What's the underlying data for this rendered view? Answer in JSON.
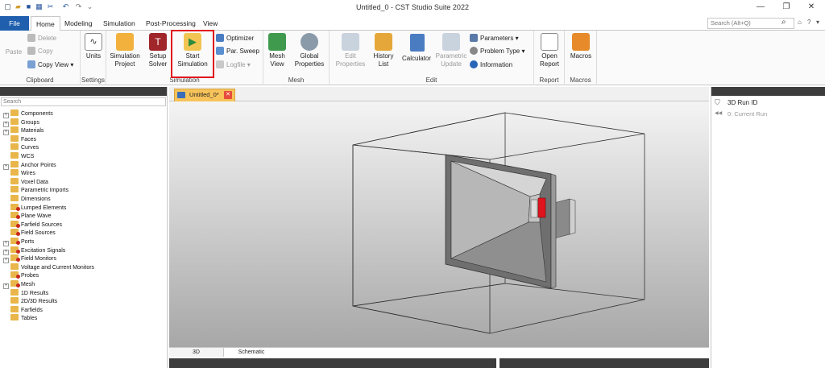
{
  "window": {
    "title": "Untitled_0 - CST Studio Suite 2022",
    "controls": [
      "minimize",
      "maximize",
      "close"
    ]
  },
  "quick_access": [
    "new-icon",
    "open-icon",
    "save-icon",
    "save-all-icon",
    "cut-icon",
    "undo-icon",
    "redo-icon",
    "customize-icon"
  ],
  "ribbon_tabs": [
    {
      "label": "File"
    },
    {
      "label": "Home"
    },
    {
      "label": "Modeling"
    },
    {
      "label": "Simulation"
    },
    {
      "label": "Post-Processing"
    },
    {
      "label": "View"
    }
  ],
  "search": {
    "placeholder": "Search (Alt+Q)"
  },
  "groups": {
    "clipboard": {
      "label": "Clipboard",
      "paste": "Paste",
      "delete": "Delete",
      "copy": "Copy",
      "copy_view": "Copy View"
    },
    "settings": {
      "label": "Settings",
      "units": "Units"
    },
    "simulation": {
      "label": "Simulation",
      "simulation_project": "Simulation Project",
      "setup_solver": "Setup Solver",
      "start_simulation": "Start Simulation",
      "optimizer": "Optimizer",
      "par_sweep": "Par. Sweep",
      "logfile": "Logfile"
    },
    "mesh": {
      "label": "Mesh",
      "mesh_view": "Mesh View",
      "global_properties": "Global Properties"
    },
    "edit": {
      "label": "Edit",
      "edit_properties": "Edit Properties",
      "history_list": "History List",
      "calculator": "Calculator",
      "parametric_update": "Parametric Update",
      "parameters": "Parameters",
      "problem_type": "Problem Type",
      "information": "Information"
    },
    "report": {
      "label": "Report",
      "open_report": "Open Report"
    },
    "macros": {
      "label": "Macros",
      "macros": "Macros"
    }
  },
  "navigation_tree": {
    "search_placeholder": "Search",
    "items": [
      {
        "label": "Components",
        "expandable": true
      },
      {
        "label": "Groups",
        "expandable": true
      },
      {
        "label": "Materials",
        "expandable": true
      },
      {
        "label": "Faces",
        "expandable": false
      },
      {
        "label": "Curves",
        "expandable": false
      },
      {
        "label": "WCS",
        "expandable": false
      },
      {
        "label": "Anchor Points",
        "expandable": true
      },
      {
        "label": "Wires",
        "expandable": false
      },
      {
        "label": "Voxel Data",
        "expandable": false
      },
      {
        "label": "Parametric Imports",
        "expandable": false
      },
      {
        "label": "Dimensions",
        "expandable": false
      },
      {
        "label": "Lumped Elements",
        "expandable": false
      },
      {
        "label": "Plane Wave",
        "expandable": false
      },
      {
        "label": "Farfield Sources",
        "expandable": false
      },
      {
        "label": "Field Sources",
        "expandable": false
      },
      {
        "label": "Ports",
        "expandable": true
      },
      {
        "label": "Excitation Signals",
        "expandable": true
      },
      {
        "label": "Field Monitors",
        "expandable": true
      },
      {
        "label": "Voltage and Current Monitors",
        "expandable": false
      },
      {
        "label": "Probes",
        "expandable": false
      },
      {
        "label": "Mesh",
        "expandable": true
      },
      {
        "label": "1D Results",
        "expandable": false
      },
      {
        "label": "2D/3D Results",
        "expandable": false
      },
      {
        "label": "Farfields",
        "expandable": false
      },
      {
        "label": "Tables",
        "expandable": false
      }
    ]
  },
  "document_tab": {
    "label": "Untitled_0*"
  },
  "view_tabs": [
    {
      "label": "3D"
    },
    {
      "label": "Schematic"
    }
  ],
  "run_panel": {
    "header": "3D Run ID",
    "current": "0: Current Run"
  },
  "colors": {
    "file_tab": "#1f5fae",
    "highlight": "#e0141e",
    "document_tab": "#f7c35a",
    "port": "#e0141e"
  }
}
